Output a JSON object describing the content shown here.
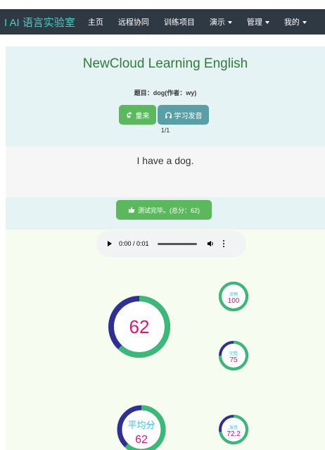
{
  "navbar": {
    "brand": "I AI 语言实验室",
    "items": [
      {
        "label": "主页",
        "dropdown": false
      },
      {
        "label": "远程协同",
        "dropdown": false
      },
      {
        "label": "训练项目",
        "dropdown": false
      },
      {
        "label": "演示",
        "dropdown": true
      },
      {
        "label": "管理",
        "dropdown": true
      },
      {
        "label": "我的",
        "dropdown": true
      }
    ]
  },
  "header": {
    "title": "NewCloud Learning English",
    "subject": "题目：dog(作者：wy)",
    "retry_label": "重来",
    "learn_label": "学习发音",
    "progress": "1/1"
  },
  "sentence": "I have a dog.",
  "result": {
    "label": "测试完毕。(总分：62)"
  },
  "audio": {
    "time": "0:00 / 0:01"
  },
  "scores": {
    "total": {
      "value": "62",
      "fraction": 0.62
    },
    "fluency": {
      "label": "流畅",
      "value": "100",
      "fraction": 1.0
    },
    "completeness": {
      "label": "完整",
      "value": "75",
      "fraction": 0.75
    },
    "average": {
      "label": "平均分",
      "value": "62",
      "fraction": 0.62
    },
    "pronunciation": {
      "label": "发音",
      "value": "72.2",
      "fraction": 0.722
    }
  },
  "colors": {
    "navbar_bg": "#2f3944",
    "brand": "#3ed0c4",
    "title": "#2f7d38",
    "button_green": "#5cb85c",
    "button_teal": "#5a9fa6",
    "ring_green": "#3cb878",
    "ring_navy": "#2e3192",
    "score_text": "#e0127a",
    "label_text": "#35c5f0"
  }
}
